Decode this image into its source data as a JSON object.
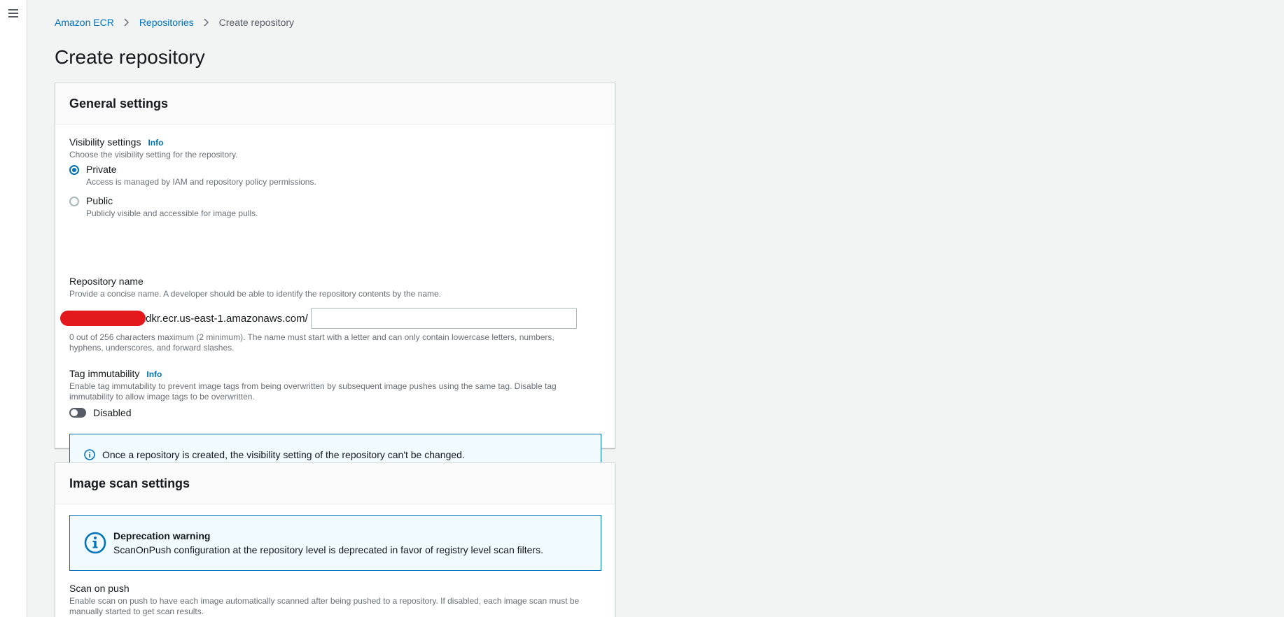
{
  "nav": {
    "menu_icon": "hamburger-menu-icon"
  },
  "breadcrumb": {
    "items": [
      "Amazon ECR",
      "Repositories"
    ],
    "current": "Create repository"
  },
  "page_title": "Create repository",
  "general": {
    "title": "General settings",
    "visibility": {
      "label": "Visibility settings",
      "info": "Info",
      "desc": "Choose the visibility setting for the repository.",
      "options": [
        {
          "label": "Private",
          "desc": "Access is managed by IAM and repository policy permissions.",
          "checked": true
        },
        {
          "label": "Public",
          "desc": "Publicly visible and accessible for image pulls.",
          "checked": false
        }
      ]
    },
    "repo_name": {
      "label": "Repository name",
      "desc": "Provide a concise name. A developer should be able to identify the repository contents by the name.",
      "prefix": "dkr.ecr.us-east-1.amazonaws.com/",
      "value": "",
      "help": "0 out of 256 characters maximum (2 minimum). The name must start with a letter and can only contain lowercase letters, numbers, hyphens, underscores, and forward slashes."
    },
    "tag_immutability": {
      "label": "Tag immutability",
      "info": "Info",
      "desc": "Enable tag immutability to prevent image tags from being overwritten by subsequent image pushes using the same tag. Disable tag immutability to allow image tags to be overwritten.",
      "toggle_label": "Disabled"
    },
    "alert": "Once a repository is created, the visibility setting of the repository can't be changed."
  },
  "image_scan": {
    "title": "Image scan settings",
    "warning_title": "Deprecation warning",
    "warning_text": "ScanOnPush configuration at the repository level is deprecated in favor of registry level scan filters.",
    "scan_on_push": {
      "label": "Scan on push",
      "desc": "Enable scan on push to have each image automatically scanned after being pushed to a repository. If disabled, each image scan must be manually started to get scan results."
    }
  },
  "colors": {
    "link": "#0073bb",
    "accent_border": "#0073bb",
    "alert_bg": "#f1faff",
    "redaction": "#e3191d"
  }
}
